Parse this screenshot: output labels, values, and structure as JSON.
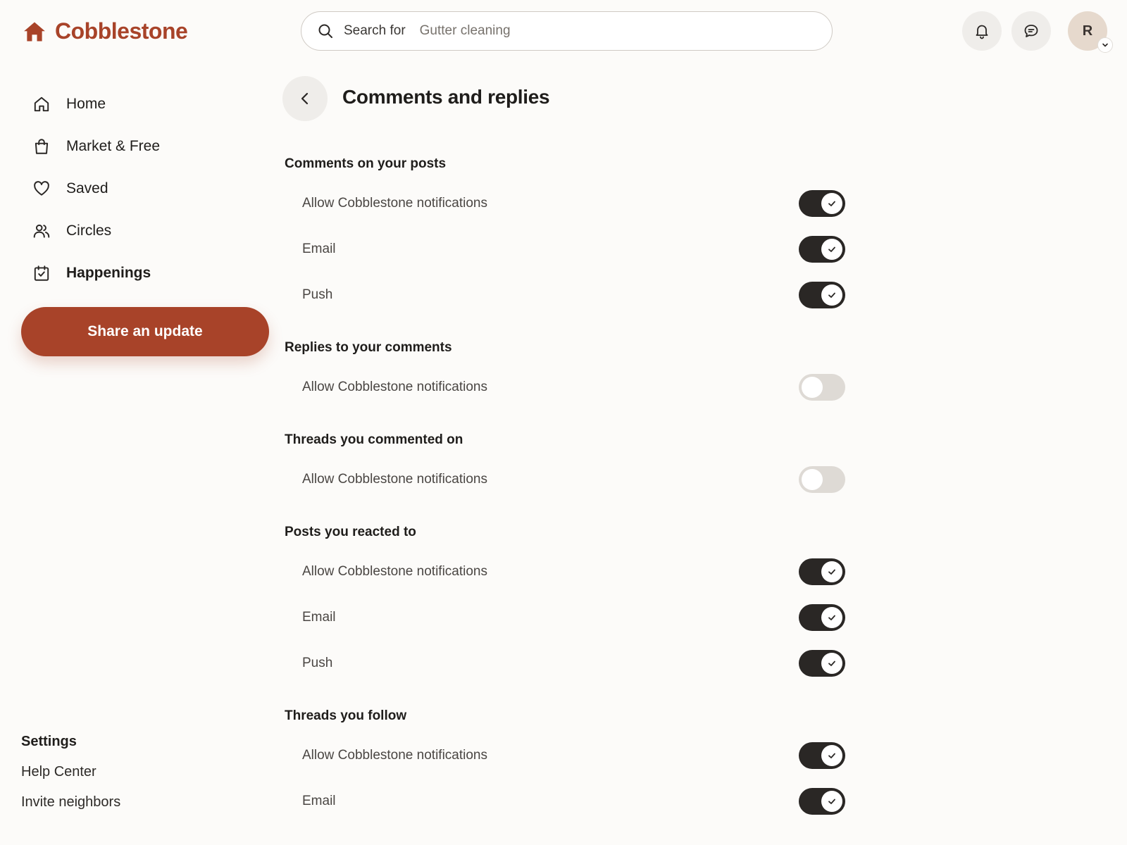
{
  "brand": {
    "name": "Cobblestone",
    "color": "#a84329",
    "icon": "house-icon"
  },
  "search": {
    "placeholder": "Search for",
    "hint": "Gutter cleaning"
  },
  "top_actions": [
    {
      "icon": "bell-icon"
    },
    {
      "icon": "chat-icon"
    }
  ],
  "user": {
    "initial": "R"
  },
  "nav": {
    "items": [
      {
        "label": "Home",
        "icon": "home-icon"
      },
      {
        "label": "Market & Free",
        "icon": "shopping-bag-icon"
      },
      {
        "label": "Saved",
        "icon": "heart-icon"
      },
      {
        "label": "Circles",
        "icon": "people-icon"
      },
      {
        "label": "Happenings",
        "icon": "calendar-check-icon"
      }
    ],
    "share_label": "Share an update"
  },
  "footer": {
    "title": "Settings",
    "links": [
      "Help Center",
      "Invite neighbors"
    ]
  },
  "page": {
    "title": "Comments and replies"
  },
  "sections": [
    {
      "title": "Comments on your posts",
      "rows": [
        {
          "label": "Allow Cobblestone notifications",
          "on": true
        },
        {
          "label": "Email",
          "on": true
        },
        {
          "label": "Push",
          "on": true
        }
      ]
    },
    {
      "title": "Replies to your comments",
      "rows": [
        {
          "label": "Allow Cobblestone notifications",
          "on": false
        }
      ]
    },
    {
      "title": "Threads you commented on",
      "rows": [
        {
          "label": "Allow Cobblestone notifications",
          "on": false
        }
      ]
    },
    {
      "title": "Posts you reacted to",
      "rows": [
        {
          "label": "Allow Cobblestone notifications",
          "on": true
        },
        {
          "label": "Email",
          "on": true
        },
        {
          "label": "Push",
          "on": true
        }
      ]
    },
    {
      "title": "Threads you follow",
      "rows": [
        {
          "label": "Allow Cobblestone notifications",
          "on": true
        },
        {
          "label": "Email",
          "on": true
        }
      ]
    }
  ]
}
